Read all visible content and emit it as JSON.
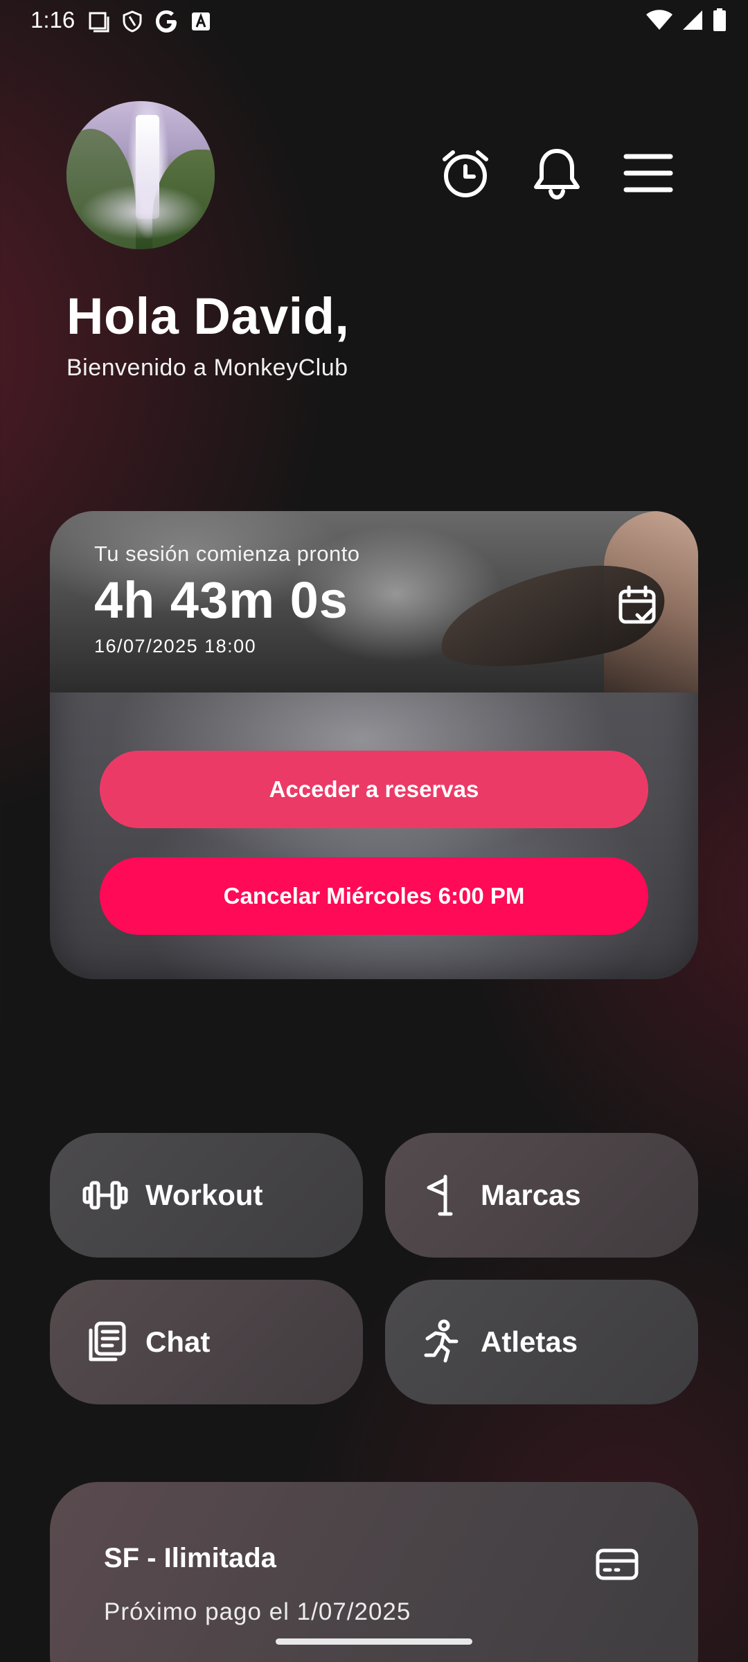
{
  "status_bar": {
    "time": "1:16",
    "left_icons": [
      "screenshot-icon",
      "shield-icon",
      "google-icon",
      "translate-icon"
    ],
    "right_icons": [
      "wifi-icon",
      "cell-signal-icon",
      "battery-icon"
    ]
  },
  "header": {
    "avatar": "profile-avatar",
    "icons": [
      "alarm-clock-icon",
      "bell-icon",
      "menu-icon"
    ]
  },
  "greeting": {
    "title": "Hola David,",
    "subtitle": "Bienvenido a MonkeyClub"
  },
  "session": {
    "label": "Tu sesión comienza pronto",
    "countdown": "4h 43m 0s",
    "datetime": "16/07/2025 18:00",
    "calendar_icon": "calendar-check-icon",
    "primary_button": "Acceder a reservas",
    "cancel_button": "Cancelar Miércoles 6:00 PM",
    "colors": {
      "primary": "#ec3a67",
      "cancel": "#ff0a57"
    }
  },
  "tiles": [
    {
      "label": "Workout",
      "icon": "dumbbell-icon"
    },
    {
      "label": "Marcas",
      "icon": "flag-icon"
    },
    {
      "label": "Chat",
      "icon": "document-stack-icon"
    },
    {
      "label": "Atletas",
      "icon": "running-person-icon"
    }
  ],
  "membership": {
    "plan": "SF - Ilimitada",
    "next_payment": "Próximo pago el 1/07/2025",
    "icon": "credit-card-icon"
  }
}
